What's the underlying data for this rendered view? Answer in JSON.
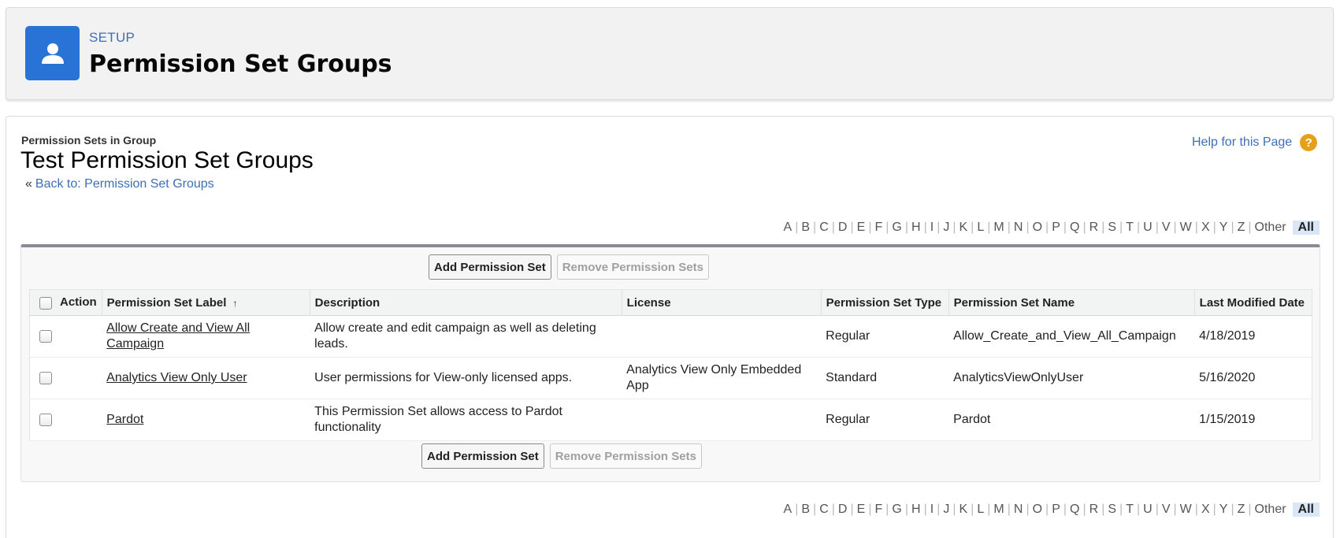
{
  "header": {
    "eyebrow": "SETUP",
    "title": "Permission Set Groups",
    "icon": "user-icon",
    "icon_color": "#2a73d6"
  },
  "page": {
    "eyebrow": "Permission Sets in Group",
    "title": "Test Permission Set Groups",
    "back_prefix": "«",
    "back_link": "Back to: Permission Set Groups",
    "help_link": "Help for this Page",
    "help_icon": "?"
  },
  "alpha_filter": {
    "letters": [
      "A",
      "B",
      "C",
      "D",
      "E",
      "F",
      "G",
      "H",
      "I",
      "J",
      "K",
      "L",
      "M",
      "N",
      "O",
      "P",
      "Q",
      "R",
      "S",
      "T",
      "U",
      "V",
      "W",
      "X",
      "Y",
      "Z"
    ],
    "other": "Other",
    "all": "All",
    "selected": "All"
  },
  "buttons": {
    "add": "Add Permission Set",
    "remove": "Remove Permission Sets"
  },
  "table": {
    "columns": [
      "Action",
      "Permission Set Label",
      "Description",
      "License",
      "Permission Set Type",
      "Permission Set Name",
      "Last Modified Date"
    ],
    "sort_indicator": "↑",
    "rows": [
      {
        "label": "Allow Create and View All Campaign",
        "description": "Allow create and edit campaign as well as deleting leads.",
        "license": "",
        "type": "Regular",
        "name": "Allow_Create_and_View_All_Campaign",
        "modified": "4/18/2019"
      },
      {
        "label": "Analytics View Only User",
        "description": "User permissions for View-only licensed apps.",
        "license": "Analytics View Only Embedded App",
        "type": "Standard",
        "name": "AnalyticsViewOnlyUser",
        "modified": "5/16/2020"
      },
      {
        "label": "Pardot",
        "description": "This Permission Set allows access to Pardot functionality",
        "license": "",
        "type": "Regular",
        "name": "Pardot",
        "modified": "1/15/2019"
      }
    ]
  }
}
